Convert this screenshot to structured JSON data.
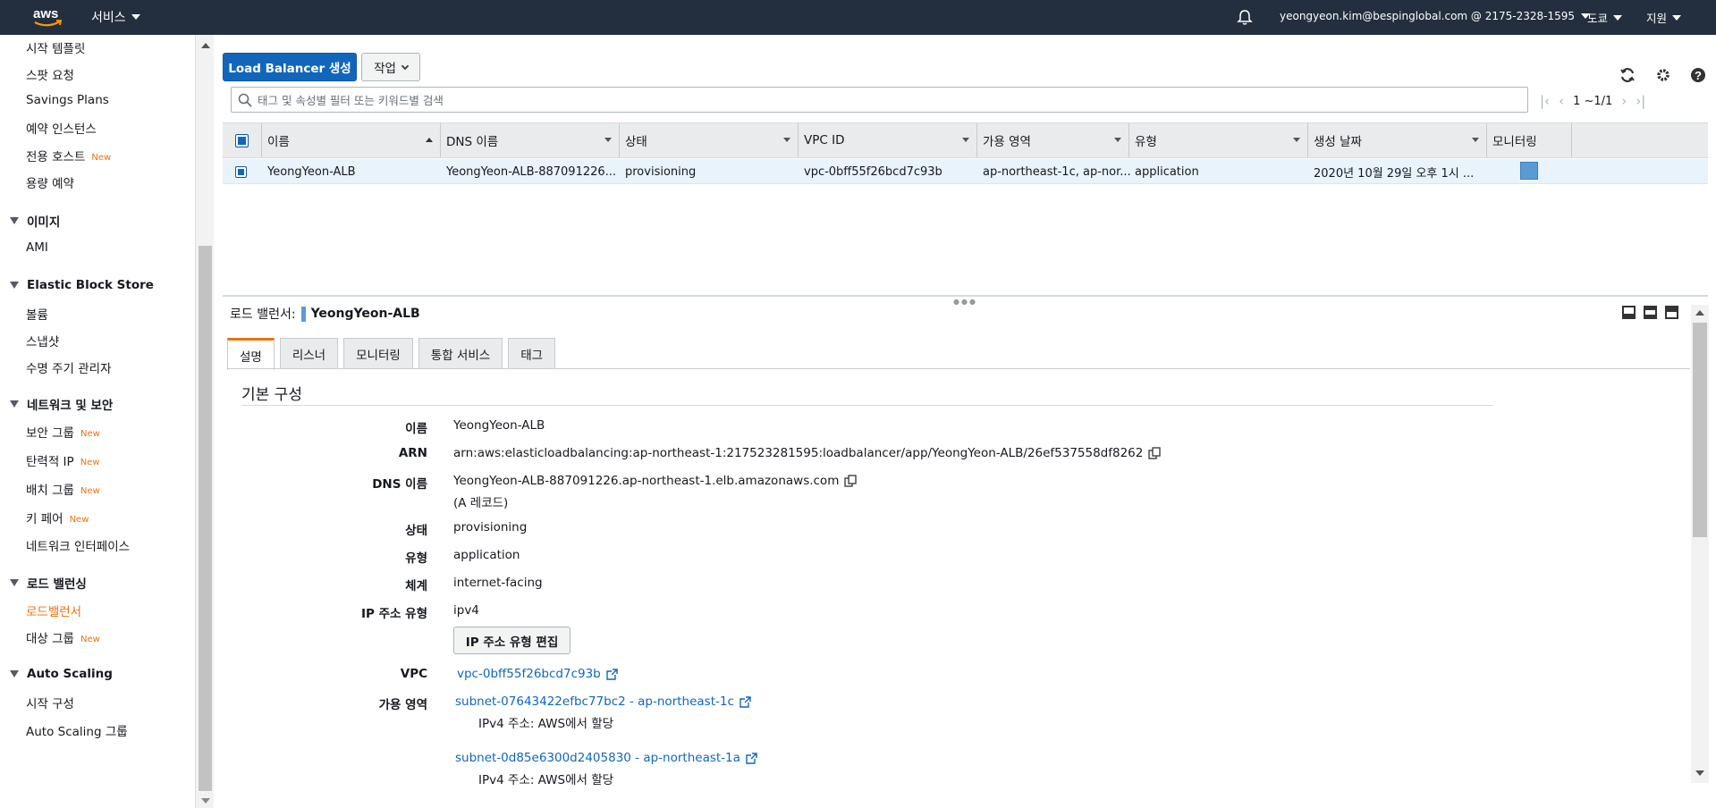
{
  "topnav": {
    "logo_text": "aws",
    "services_label": "서비스",
    "account_label": "yeongyeon.kim@bespinglobal.com @ 2175-2328-1595",
    "region_label": "도쿄",
    "support_label": "지원"
  },
  "sidebar": {
    "items_top": [
      {
        "label": "시작 템플릿",
        "new": ""
      },
      {
        "label": "스팟 요청",
        "new": ""
      },
      {
        "label": "Savings Plans",
        "new": ""
      },
      {
        "label": "예약 인스턴스",
        "new": ""
      },
      {
        "label": "전용 호스트",
        "new": "New"
      },
      {
        "label": "용량 예약",
        "new": ""
      }
    ],
    "section_images": "이미지",
    "images_items": [
      "AMI"
    ],
    "section_ebs": "Elastic Block Store",
    "ebs_items": [
      "볼륨",
      "스냅샷",
      "수명 주기 관리자"
    ],
    "section_network": "네트워크 및 보안",
    "network_items": [
      {
        "label": "보안 그룹",
        "new": "New"
      },
      {
        "label": "탄력적 IP",
        "new": "New"
      },
      {
        "label": "배치 그룹",
        "new": "New"
      },
      {
        "label": "키 페어",
        "new": "New"
      },
      {
        "label": "네트워크 인터페이스",
        "new": ""
      }
    ],
    "section_lb": "로드 밸런싱",
    "lb_items": [
      {
        "label": "로드밸런서",
        "new": ""
      },
      {
        "label": "대상 그룹",
        "new": "New"
      }
    ],
    "section_autoscaling": "Auto Scaling",
    "autoscaling_items": [
      "시작 구성",
      "Auto Scaling 그룹"
    ]
  },
  "toolbar": {
    "create_button": "Load Balancer 생성",
    "action_button": "작업",
    "search_placeholder": "태그 및 속성별 필터 또는 키워드별 검색",
    "pager_text": "1 ~1/1"
  },
  "table": {
    "columns": [
      "이름",
      "DNS 이름",
      "상태",
      "VPC ID",
      "가용 영역",
      "유형",
      "생성 날짜",
      "모니터링"
    ],
    "row": {
      "name": "YeongYeon-ALB",
      "dns": "YeongYeon-ALB-887091226...",
      "state": "provisioning",
      "vpc": "vpc-0bff55f26bcd7c93b",
      "az": "ap-northeast-1c, ap-nor...",
      "type": "application",
      "created": "2020년 10월 29일 오후 1시 ..."
    }
  },
  "detail": {
    "header_label": "로드 밸런서:",
    "header_name": "YeongYeon-ALB",
    "tabs": [
      "설명",
      "리스너",
      "모니터링",
      "통합 서비스",
      "태그"
    ],
    "section_title": "기본 구성",
    "labels": {
      "name": "이름",
      "arn": "ARN",
      "dns": "DNS 이름",
      "state": "상태",
      "type": "유형",
      "scheme": "체계",
      "ip_type": "IP 주소 유형",
      "vpc": "VPC",
      "az": "가용 영역"
    },
    "values": {
      "name": "YeongYeon-ALB",
      "arn": "arn:aws:elasticloadbalancing:ap-northeast-1:217523281595:loadbalancer/app/YeongYeon-ALB/26ef537558df8262",
      "dns": "YeongYeon-ALB-887091226.ap-northeast-1.elb.amazonaws.com",
      "dns_note": "(A 레코드)",
      "state": "provisioning",
      "type": "application",
      "scheme": "internet-facing",
      "ip_type": "ipv4",
      "edit_ip_button": "IP 주소 유형 편집",
      "vpc": "vpc-0bff55f26bcd7c93b",
      "subnet1": "subnet-07643422efbc77bc2 - ap-northeast-1c",
      "subnet1_note": "IPv4 주소: AWS에서 할당",
      "subnet2": "subnet-0d85e6300d2405830 - ap-northeast-1a",
      "subnet2_note": "IPv4 주소: AWS에서 할당"
    }
  },
  "colors": {
    "nav_bg": "#232f3e",
    "primary": "#1166bb",
    "accent": "#ec7211",
    "selected_row": "#e8f3fb"
  }
}
